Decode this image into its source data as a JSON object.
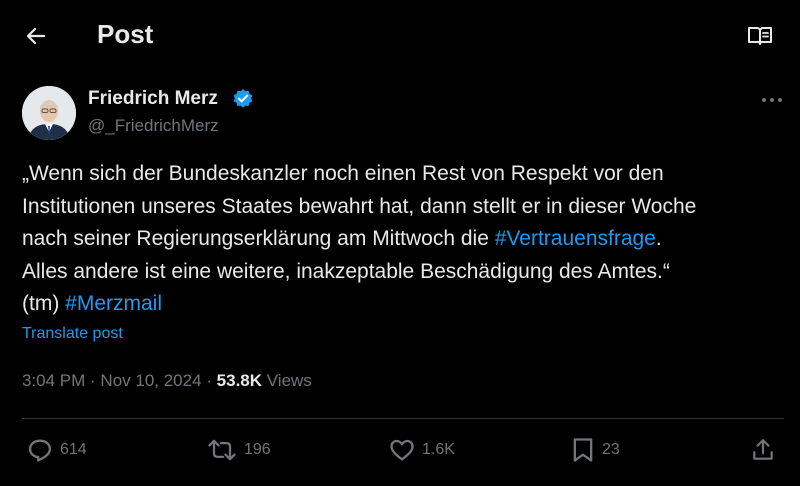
{
  "header": {
    "title": "Post"
  },
  "author": {
    "name": "Friedrich Merz",
    "handle": "@_FriedrichMerz"
  },
  "tweet": {
    "line1": "„Wenn sich der Bundeskanzler noch einen Rest von Respekt vor den",
    "line2": "Institutionen unseres Staates bewahrt hat, dann stellt er in dieser Woche",
    "line3_pre": "nach seiner Regierungserklärung am Mittwoch die ",
    "hashtag1": "#Vertrauensfrage",
    "line3_post": ".",
    "line4": "Alles andere ist eine weitere, inakzeptable Beschädigung des Amtes.“",
    "line5_pre": "(tm) ",
    "hashtag2": "#Merzmail"
  },
  "translate_label": "Translate post",
  "meta": {
    "time": "3:04 PM",
    "sep1": " · ",
    "date": "Nov 10, 2024",
    "sep2": " · ",
    "views_count": "53.8K",
    "views_label": " Views"
  },
  "actions": {
    "replies": "614",
    "reposts": "196",
    "likes": "1.6K",
    "bookmarks": "23"
  },
  "colors": {
    "accent": "#1d9bf0",
    "background": "#000000",
    "text": "#e7e9ea",
    "muted": "#71767b"
  },
  "icons": [
    "back-arrow-icon",
    "reader-mode-icon",
    "verified-badge-icon",
    "more-options-icon",
    "reply-icon",
    "repost-icon",
    "like-icon",
    "bookmark-icon",
    "share-icon"
  ]
}
